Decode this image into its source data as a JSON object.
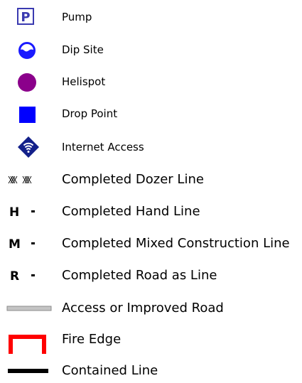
{
  "legend": {
    "items": [
      {
        "label": "Pump",
        "icon": "pump-icon",
        "glyph": "P",
        "color": "#3a3ab0"
      },
      {
        "label": "Dip Site",
        "icon": "dip-site-icon",
        "color": "#1a1aff"
      },
      {
        "label": "Helispot",
        "icon": "helispot-icon",
        "color": "#8b008b"
      },
      {
        "label": "Drop Point",
        "icon": "drop-point-icon",
        "color": "#0000ff"
      },
      {
        "label": "Internet Access",
        "icon": "internet-access-icon",
        "color": "#13208a"
      },
      {
        "label": "Completed Dozer Line",
        "icon": "dozer-line-icon",
        "color": "#000000"
      },
      {
        "label": "Completed Hand Line",
        "icon": "hand-line-icon",
        "glyph": "H",
        "color": "#000000"
      },
      {
        "label": "Completed Mixed Construction Line",
        "icon": "mixed-line-icon",
        "glyph": "M",
        "color": "#000000"
      },
      {
        "label": "Completed Road as Line",
        "icon": "road-line-icon",
        "glyph": "R",
        "color": "#000000"
      },
      {
        "label": "Access or Improved Road",
        "icon": "road-icon",
        "color": "#b0b0b0"
      },
      {
        "label": "Fire Edge",
        "icon": "fire-edge-icon",
        "color": "#ff0000"
      },
      {
        "label": "Contained Line",
        "icon": "contained-line-icon",
        "color": "#000000"
      }
    ]
  }
}
